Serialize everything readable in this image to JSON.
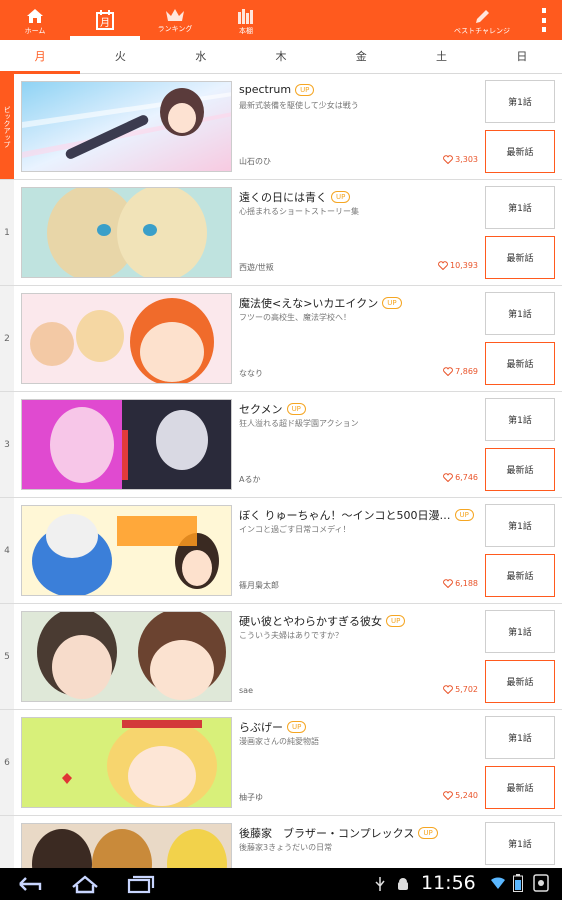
{
  "nav": {
    "items": [
      {
        "label": "ホーム",
        "icon": "home-icon"
      },
      {
        "label": "",
        "icon": "calendar-icon",
        "icon_text": "月"
      },
      {
        "label": "ランキング",
        "icon": "crown-icon"
      },
      {
        "label": "本棚",
        "icon": "bookshelf-icon"
      },
      {
        "label": "ベストチャレンジ",
        "icon": "pen-icon"
      }
    ]
  },
  "days": [
    "月",
    "火",
    "水",
    "木",
    "金",
    "土",
    "日"
  ],
  "pickup_label": "ピックアップ",
  "badge_up": "UP",
  "buttons": {
    "first": "第1話",
    "latest": "最新話"
  },
  "comics": [
    {
      "rank": "",
      "title": "spectrum",
      "desc": "最新式装備を駆使して少女は戦う",
      "author": "山石のひ",
      "likes": "3,303"
    },
    {
      "rank": "1",
      "title": "遠くの日には青く",
      "desc": "心揺まれるショートストーリー集",
      "author": "西遊/世叛",
      "likes": "10,393"
    },
    {
      "rank": "2",
      "title": "魔法使<えな>いカエイクン",
      "desc": "フツーの高校生、魔法学校へ！",
      "author": "ななり",
      "likes": "7,869"
    },
    {
      "rank": "3",
      "title": "セクメン",
      "desc": "狂人溢れる超ド級学園アクション",
      "author": "Aるか",
      "likes": "6,746"
    },
    {
      "rank": "4",
      "title": "ぼく りゅーちゃん！～インコと500日漫…",
      "desc": "インコと過ごす日常コメディ！",
      "author": "篠月梟太郎",
      "likes": "6,188"
    },
    {
      "rank": "5",
      "title": "硬い彼とやわらかすぎる彼女",
      "desc": "こういう夫婦はありですか？",
      "author": "sae",
      "likes": "5,702"
    },
    {
      "rank": "6",
      "title": "らぶげー",
      "desc": "漫画家さんの純愛物語",
      "author": "柚子ゆ",
      "likes": "5,240"
    },
    {
      "rank": "",
      "title": "後藤家　ブラザー・コンプレックス",
      "desc": "後藤家3きょうだいの日常",
      "author": "",
      "likes": ""
    }
  ],
  "status": {
    "time": "11:56"
  },
  "colors": {
    "accent": "#ff5a1e",
    "badge": "#f5a623"
  }
}
